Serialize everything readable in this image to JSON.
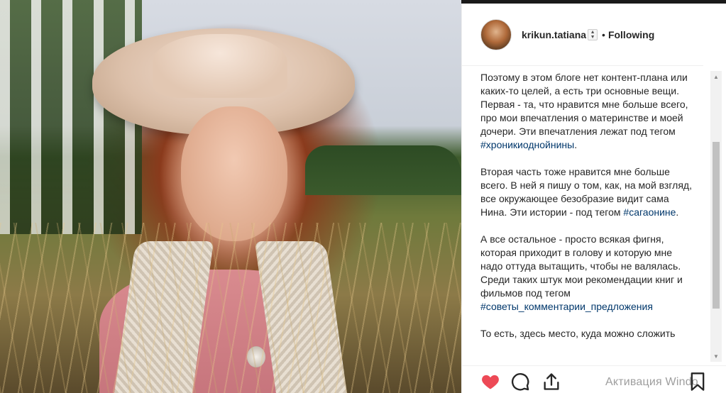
{
  "post": {
    "username": "krikun.tatiana",
    "separator": "•",
    "follow_status": "Following",
    "caption_paragraphs": [
      {
        "text": "Поэтому в этом блоге нет контент-плана или каких-то целей, а есть три основные вещи. Первая - та, что нравится мне больше всего, про мои впечатления о материнстве и моей дочери. Эти впечатления лежат под тегом ",
        "hashtag": "#хроникиоднойнины",
        "after": "."
      },
      {
        "text": "Вторая часть тоже нравится мне больше всего. В ней я пишу о том, как, на мой взгляд, все окружающее безобразие видит сама Нина. Эти истории - под тегом ",
        "hashtag": "#сагаонине",
        "after": "."
      },
      {
        "text": "А все остальное - просто всякая фигня, которая приходит в голову и которую мне надо оттуда вытащить, чтобы не валялась. Среди таких штук мои рекомендации книг и фильмов под тегом ",
        "hashtag": "#советы_комментарии_предложения",
        "after": ""
      },
      {
        "text": "То есть, здесь место, куда можно сложить",
        "hashtag": "",
        "after": ""
      }
    ]
  },
  "actions": {
    "like_icon": "heart-icon",
    "comment_icon": "comment-icon",
    "share_icon": "share-icon",
    "save_icon": "bookmark-icon",
    "liked": true
  },
  "overlay": {
    "windows_watermark": "Активация Windo"
  },
  "colors": {
    "text": "#262626",
    "hashtag": "#00376b",
    "like_red": "#ed4956",
    "border": "#efefef"
  }
}
